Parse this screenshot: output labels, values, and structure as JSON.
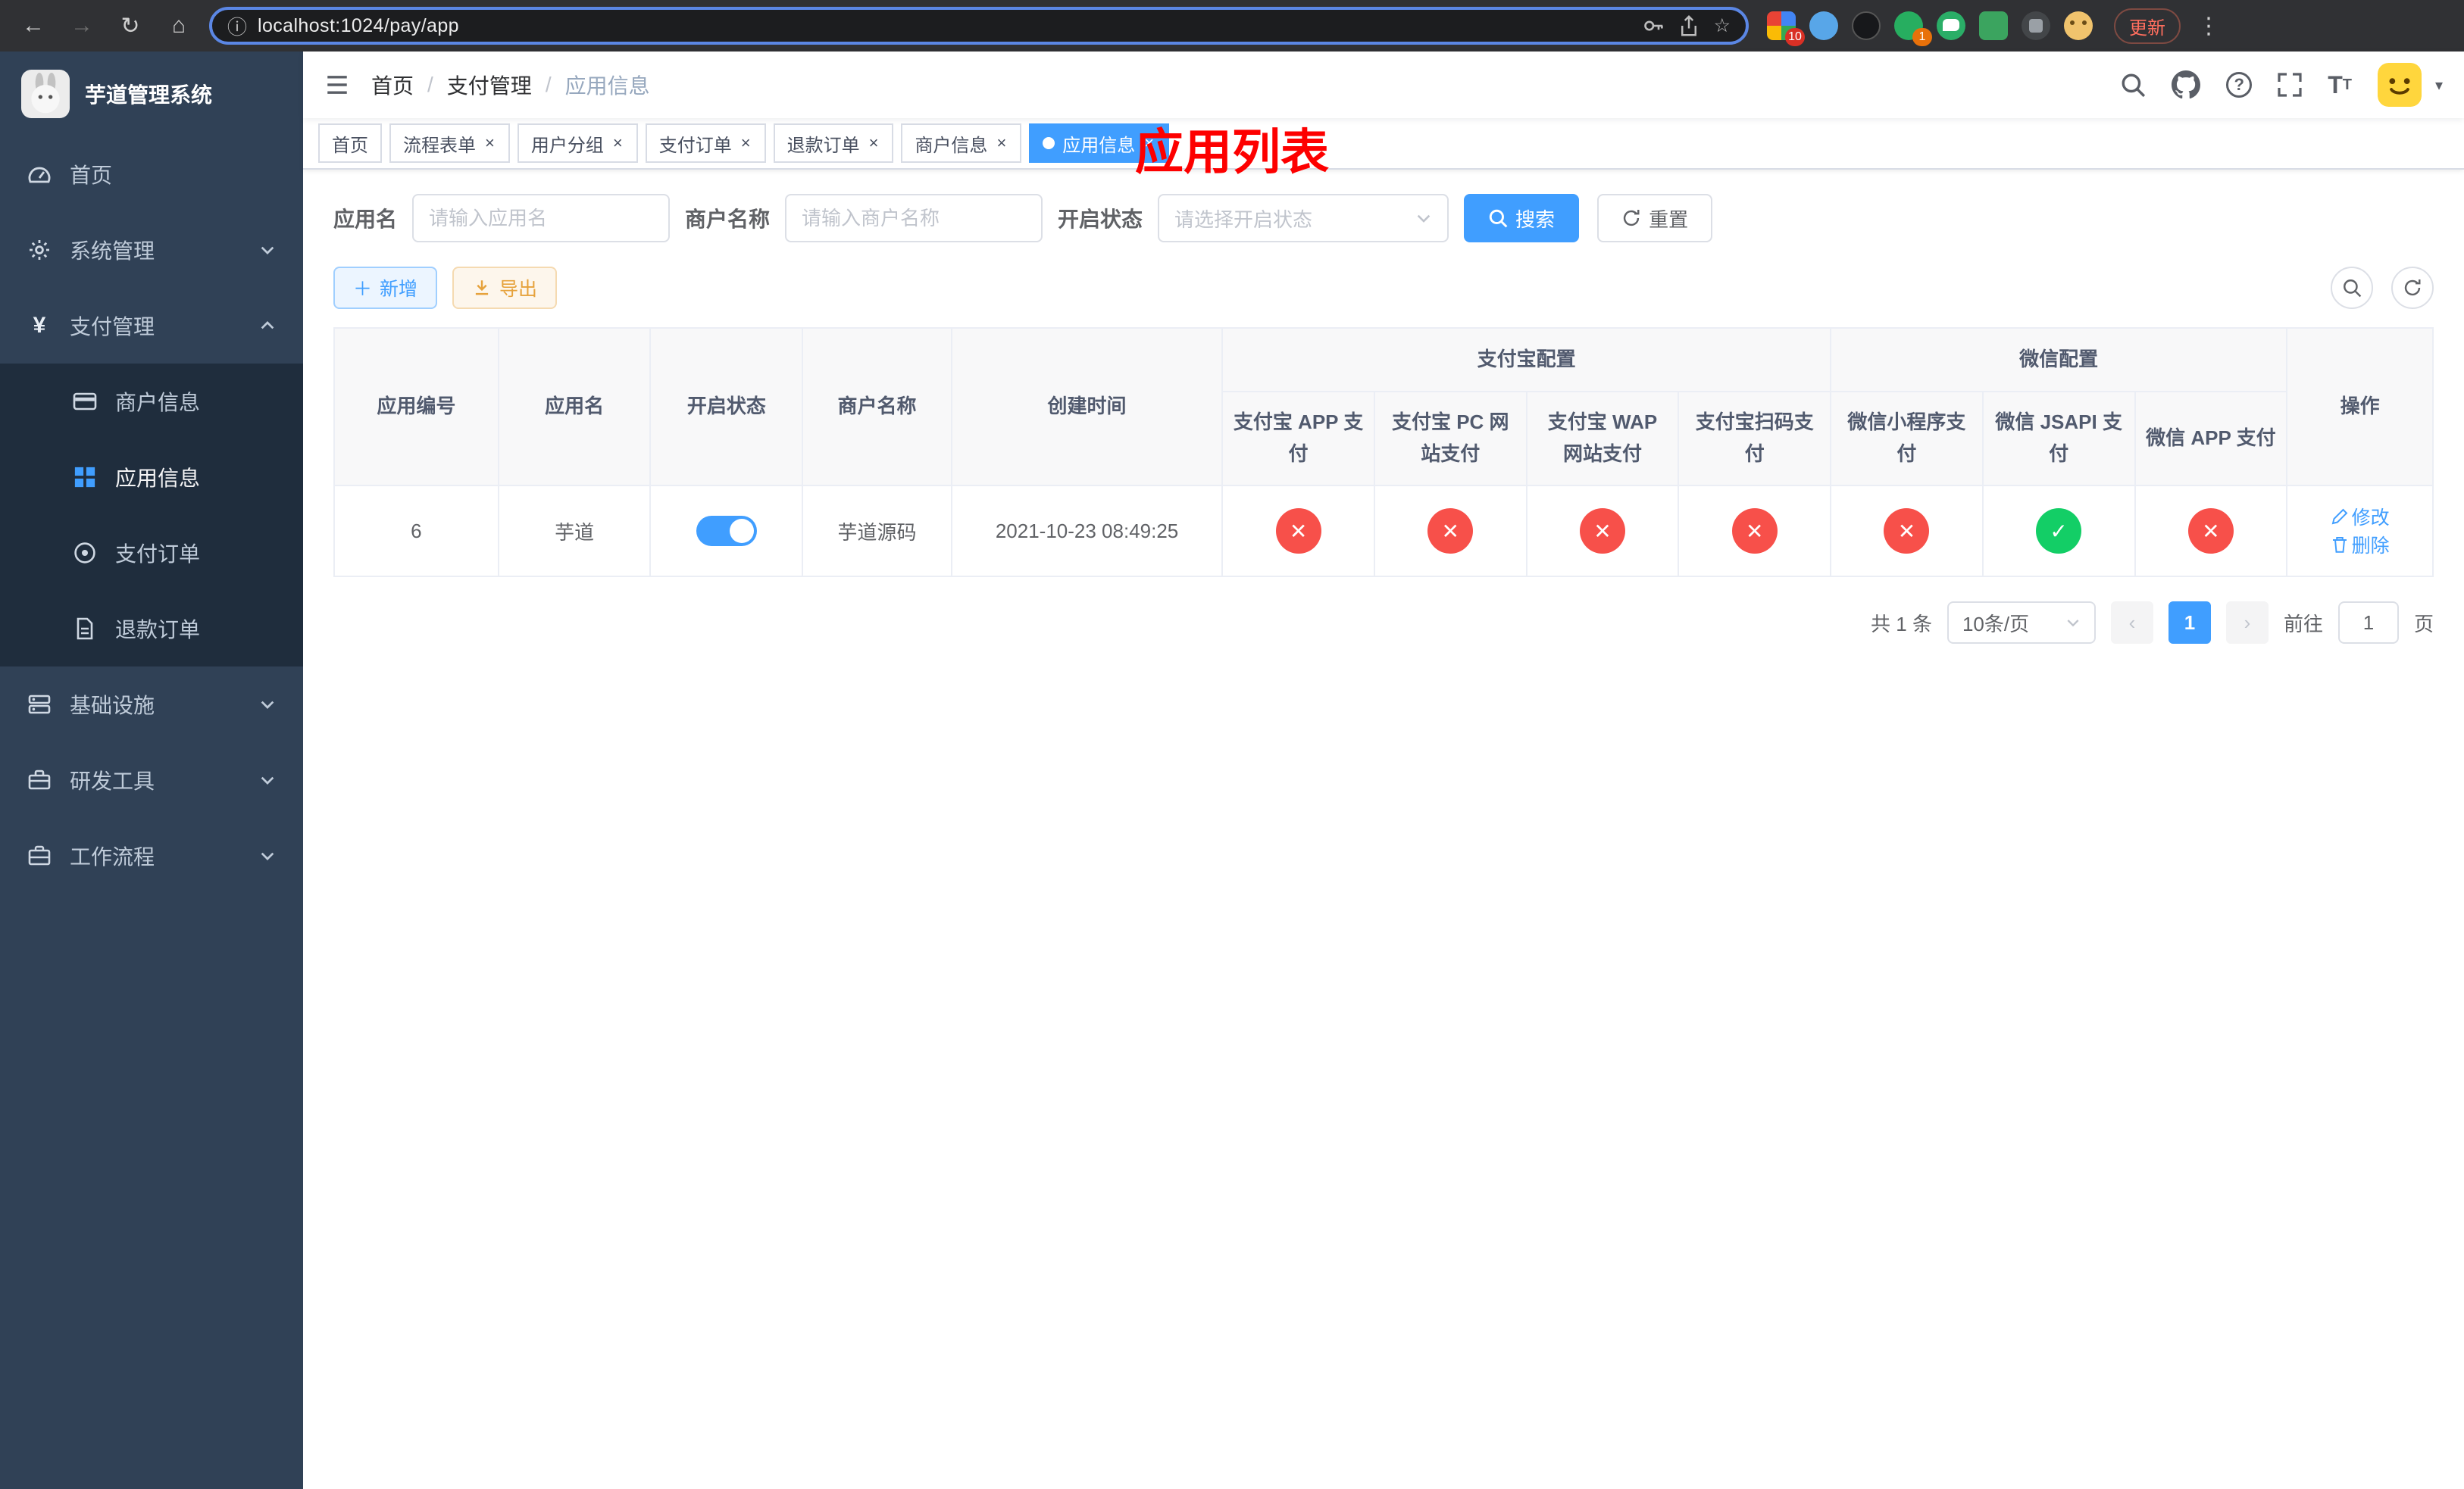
{
  "browser": {
    "url": "localhost:1024/pay/app",
    "update_label": "更新",
    "ext_badge_grid": "10",
    "ext_badge_green": "1"
  },
  "sidebar": {
    "title": "芋道管理系统",
    "items": [
      {
        "label": "首页"
      },
      {
        "label": "系统管理"
      },
      {
        "label": "支付管理"
      },
      {
        "label": "商户信息"
      },
      {
        "label": "应用信息"
      },
      {
        "label": "支付订单"
      },
      {
        "label": "退款订单"
      },
      {
        "label": "基础设施"
      },
      {
        "label": "研发工具"
      },
      {
        "label": "工作流程"
      }
    ]
  },
  "breadcrumb": {
    "items": [
      "首页",
      "支付管理",
      "应用信息"
    ],
    "separator": "/"
  },
  "page_title": "应用列表",
  "tabs": [
    {
      "label": "首页"
    },
    {
      "label": "流程表单"
    },
    {
      "label": "用户分组"
    },
    {
      "label": "支付订单"
    },
    {
      "label": "退款订单"
    },
    {
      "label": "商户信息"
    },
    {
      "label": "应用信息"
    }
  ],
  "filters": {
    "app_name_label": "应用名",
    "app_name_placeholder": "请输入应用名",
    "merchant_label": "商户名称",
    "merchant_placeholder": "请输入商户名称",
    "status_label": "开启状态",
    "status_placeholder": "请选择开启状态",
    "search_label": "搜索",
    "reset_label": "重置"
  },
  "toolbar": {
    "add_label": "新增",
    "export_label": "导出"
  },
  "table": {
    "group_alipay": "支付宝配置",
    "group_wechat": "微信配置",
    "columns": [
      "应用编号",
      "应用名",
      "开启状态",
      "商户名称",
      "创建时间",
      "支付宝 APP 支付",
      "支付宝 PC 网站支付",
      "支付宝 WAP 网站支付",
      "支付宝扫码支付",
      "微信小程序支付",
      "微信 JSAPI 支付",
      "微信 APP 支付",
      "操作"
    ],
    "rows": [
      {
        "id": "6",
        "name": "芋道",
        "enabled": true,
        "merchant": "芋道源码",
        "created": "2021-10-23 08:49:25",
        "alipay_app": false,
        "alipay_pc": false,
        "alipay_wap": false,
        "alipay_qr": false,
        "wx_mini": false,
        "wx_jsapi": true,
        "wx_app": false,
        "edit_label": "修改",
        "delete_label": "删除"
      }
    ]
  },
  "pagination": {
    "total": "共 1 条",
    "page_size": "10条/页",
    "current_page": "1",
    "goto_prefix": "前往",
    "goto_value": "1",
    "goto_suffix": "页"
  }
}
